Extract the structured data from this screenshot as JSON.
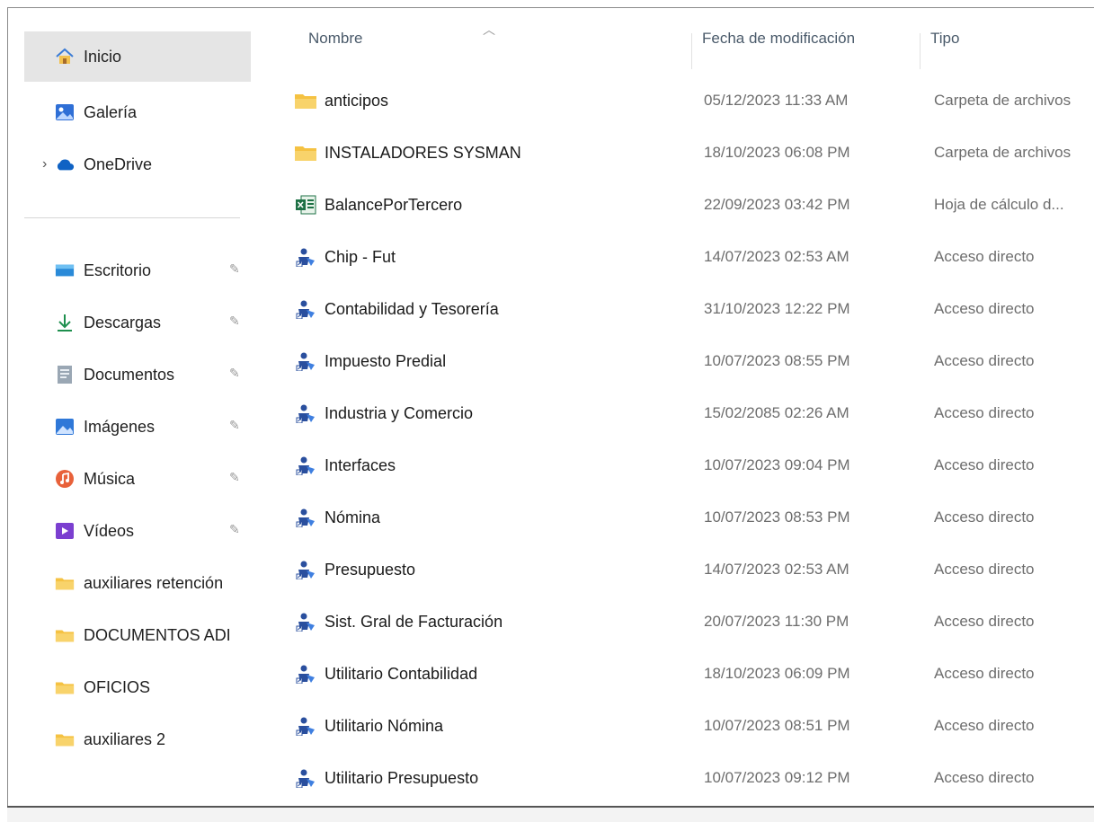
{
  "sidebar": {
    "top_items": [
      {
        "label": "Inicio",
        "icon": "home-icon"
      },
      {
        "label": "Galería",
        "icon": "gallery-icon"
      },
      {
        "label": "OneDrive",
        "icon": "onedrive-cloud-icon"
      }
    ],
    "quick_access": [
      {
        "label": "Escritorio",
        "icon": "desktop-icon",
        "pinned": true
      },
      {
        "label": "Descargas",
        "icon": "download-icon",
        "pinned": true
      },
      {
        "label": "Documentos",
        "icon": "documents-icon",
        "pinned": true
      },
      {
        "label": "Imágenes",
        "icon": "pictures-icon",
        "pinned": true
      },
      {
        "label": "Música",
        "icon": "music-icon",
        "pinned": true
      },
      {
        "label": "Vídeos",
        "icon": "videos-icon",
        "pinned": true
      },
      {
        "label": "auxiliares retención",
        "icon": "folder-icon",
        "pinned": false
      },
      {
        "label": "DOCUMENTOS ADI",
        "icon": "folder-icon",
        "pinned": false
      },
      {
        "label": "OFICIOS",
        "icon": "folder-icon",
        "pinned": false
      },
      {
        "label": "auxiliares 2",
        "icon": "folder-icon",
        "pinned": false
      }
    ]
  },
  "columns": {
    "name": "Nombre",
    "date": "Fecha de modificación",
    "type": "Tipo"
  },
  "files": [
    {
      "name": "anticipos",
      "date": "05/12/2023 11:33 AM",
      "type": "Carpeta de archivos",
      "icon": "folder-icon"
    },
    {
      "name": "INSTALADORES SYSMAN",
      "date": "18/10/2023 06:08 PM",
      "type": "Carpeta de archivos",
      "icon": "folder-icon"
    },
    {
      "name": "BalancePorTercero",
      "date": "22/09/2023 03:42 PM",
      "type": "Hoja de cálculo d...",
      "icon": "excel-icon"
    },
    {
      "name": "Chip - Fut",
      "date": "14/07/2023 02:53 AM",
      "type": "Acceso directo",
      "icon": "shortcut-app-icon"
    },
    {
      "name": "Contabilidad y Tesorería",
      "date": "31/10/2023 12:22 PM",
      "type": "Acceso directo",
      "icon": "shortcut-app-icon"
    },
    {
      "name": "Impuesto Predial",
      "date": "10/07/2023 08:55 PM",
      "type": "Acceso directo",
      "icon": "shortcut-app-icon"
    },
    {
      "name": "Industria y Comercio",
      "date": "15/02/2085 02:26 AM",
      "type": "Acceso directo",
      "icon": "shortcut-app-icon"
    },
    {
      "name": "Interfaces",
      "date": "10/07/2023 09:04 PM",
      "type": "Acceso directo",
      "icon": "shortcut-app-icon"
    },
    {
      "name": "Nómina",
      "date": "10/07/2023 08:53 PM",
      "type": "Acceso directo",
      "icon": "shortcut-app-icon"
    },
    {
      "name": "Presupuesto",
      "date": "14/07/2023 02:53 AM",
      "type": "Acceso directo",
      "icon": "shortcut-app-icon"
    },
    {
      "name": "Sist. Gral de Facturación",
      "date": "20/07/2023 11:30 PM",
      "type": "Acceso directo",
      "icon": "shortcut-app-icon"
    },
    {
      "name": "Utilitario Contabilidad",
      "date": "18/10/2023 06:09 PM",
      "type": "Acceso directo",
      "icon": "shortcut-app-icon"
    },
    {
      "name": "Utilitario Nómina",
      "date": "10/07/2023 08:51 PM",
      "type": "Acceso directo",
      "icon": "shortcut-app-icon"
    },
    {
      "name": "Utilitario Presupuesto",
      "date": "10/07/2023 09:12 PM",
      "type": "Acceso directo",
      "icon": "shortcut-app-icon"
    }
  ],
  "colors": {
    "folder": "#f5c242",
    "selected_bg": "#e5e5e5",
    "header_text": "#4a5a6a",
    "secondary_text": "#6d6d6d",
    "onedrive": "#0f62c4"
  }
}
